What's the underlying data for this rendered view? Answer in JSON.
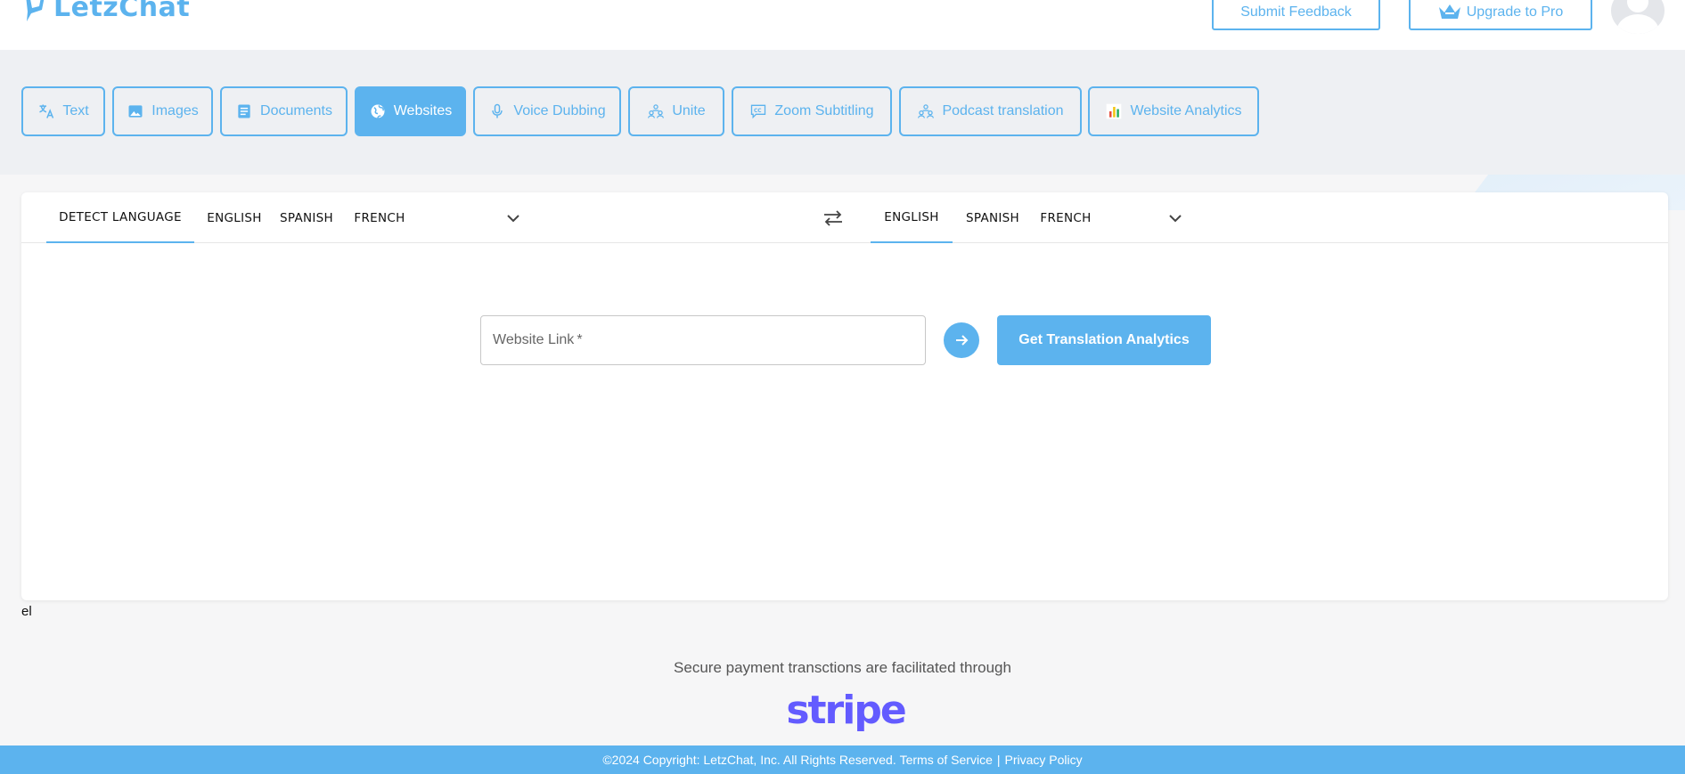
{
  "header": {
    "logo_text": "LetzChat",
    "feedback_label": "Submit Feedback",
    "upgrade_label": "Upgrade to Pro"
  },
  "tabs": [
    {
      "label": "Text",
      "icon": "translate-icon"
    },
    {
      "label": "Images",
      "icon": "image-icon"
    },
    {
      "label": "Documents",
      "icon": "document-icon"
    },
    {
      "label": "Websites",
      "icon": "globe-icon",
      "active": true
    },
    {
      "label": "Voice Dubbing",
      "icon": "microphone-icon"
    },
    {
      "label": "Unite",
      "icon": "people-icon"
    },
    {
      "label": "Zoom Subtitling",
      "icon": "cc-icon"
    },
    {
      "label": "Podcast translation",
      "icon": "people-icon"
    },
    {
      "label": "Website Analytics",
      "icon": "bar-chart-icon"
    }
  ],
  "source_languages": [
    "DETECT LANGUAGE",
    "ENGLISH",
    "SPANISH",
    "FRENCH"
  ],
  "target_languages": [
    "ENGLISH",
    "SPANISH",
    "FRENCH"
  ],
  "input": {
    "placeholder": "Website Link",
    "required_mark": "*",
    "value": ""
  },
  "analytics_button_label": "Get Translation Analytics",
  "stray_text": "el",
  "secure_text": "Secure payment transctions are facilitated through",
  "stripe_logo": "stripe",
  "footer": {
    "copyright": "©2024 Copyright: LetzChat, Inc. All Rights Reserved.",
    "terms": "Terms of Service",
    "separator": "|",
    "privacy": "Privacy Policy"
  },
  "colors": {
    "accent": "#5cb3ee",
    "stripe": "#635bff"
  }
}
